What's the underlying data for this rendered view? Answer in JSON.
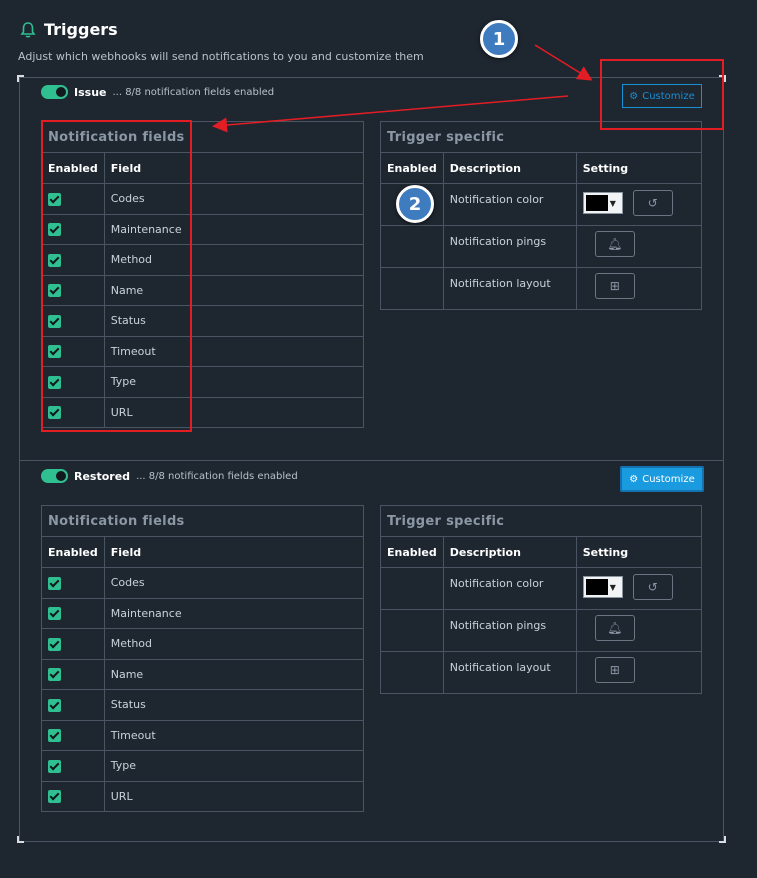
{
  "header": {
    "title": "Triggers",
    "subtitle": "Adjust which webhooks will send notifications to you and customize them"
  },
  "sections": [
    {
      "name": "Issue",
      "status": "... 8/8 notification fields enabled",
      "customize_label": "Customize",
      "notification_fields": {
        "caption": "Notification fields",
        "col_enabled": "Enabled",
        "col_field": "Field",
        "rows": [
          "Codes",
          "Maintenance",
          "Method",
          "Name",
          "Status",
          "Timeout",
          "Type",
          "URL"
        ]
      },
      "trigger_specific": {
        "caption": "Trigger specific",
        "col_enabled": "Enabled",
        "col_description": "Description",
        "col_setting": "Setting",
        "rows": [
          "Notification color",
          "Notification pings",
          "Notification layout"
        ]
      }
    },
    {
      "name": "Restored",
      "status": "... 8/8 notification fields enabled",
      "customize_label": "Customize",
      "notification_fields": {
        "caption": "Notification fields",
        "col_enabled": "Enabled",
        "col_field": "Field",
        "rows": [
          "Codes",
          "Maintenance",
          "Method",
          "Name",
          "Status",
          "Timeout",
          "Type",
          "URL"
        ]
      },
      "trigger_specific": {
        "caption": "Trigger specific",
        "col_enabled": "Enabled",
        "col_description": "Description",
        "col_setting": "Setting",
        "rows": [
          "Notification color",
          "Notification pings",
          "Notification layout"
        ]
      }
    }
  ],
  "annotations": {
    "badge_1": "1",
    "badge_2": "2"
  },
  "colors": {
    "background": "#1e2630",
    "accent_green": "#2fbf91",
    "accent_blue": "#1a9be0",
    "annotation_red": "#e31d24",
    "notification_color_value": "#000000"
  },
  "icons": [
    "bell-icon",
    "cog-icon",
    "reset-icon",
    "ping-bell-icon",
    "layout-grid-icon"
  ]
}
